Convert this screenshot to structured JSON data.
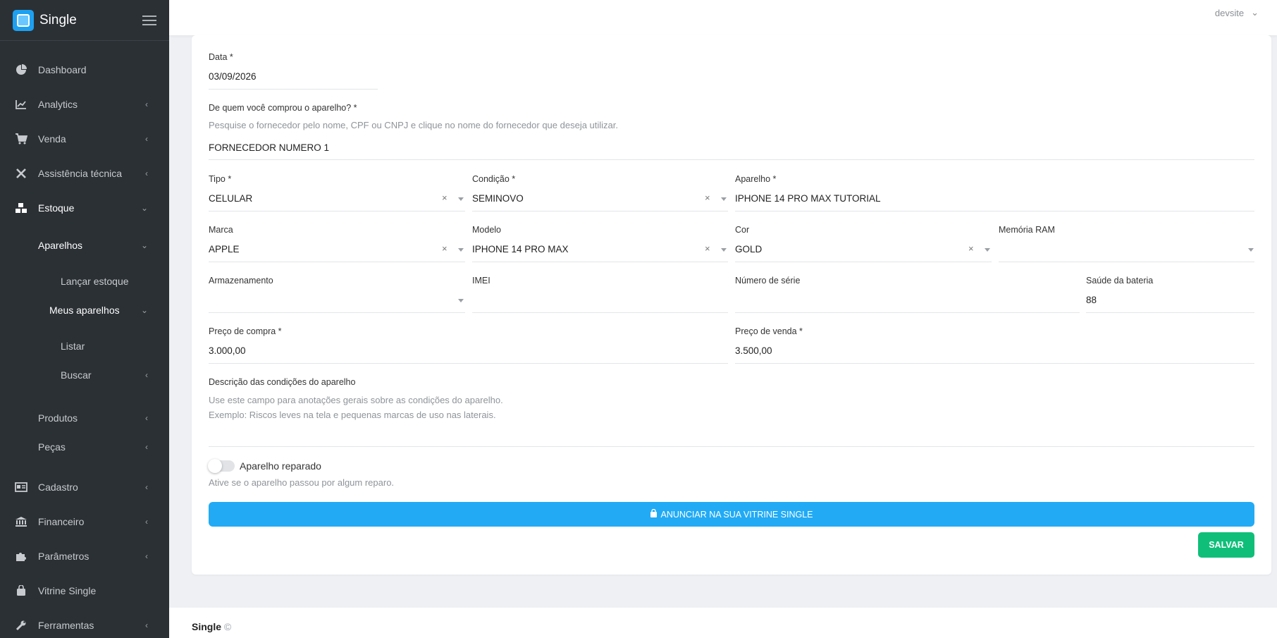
{
  "app": {
    "brand": "Single",
    "user": "devsite"
  },
  "sidebar": {
    "items": [
      {
        "label": "Dashboard",
        "icon": "pie-chart-icon"
      },
      {
        "label": "Analytics",
        "icon": "line-chart-icon"
      },
      {
        "label": "Venda",
        "icon": "cart-icon"
      },
      {
        "label": "Assistência técnica",
        "icon": "tools-icon"
      },
      {
        "label": "Estoque",
        "icon": "cubes-icon"
      },
      {
        "label": "Aparelhos"
      },
      {
        "label": "Lançar estoque"
      },
      {
        "label": "Meus aparelhos"
      },
      {
        "label": "Listar"
      },
      {
        "label": "Buscar"
      },
      {
        "label": "Produtos"
      },
      {
        "label": "Peças"
      },
      {
        "label": "Cadastro",
        "icon": "id-card-icon"
      },
      {
        "label": "Financeiro",
        "icon": "bank-icon"
      },
      {
        "label": "Parâmetros",
        "icon": "puzzle-icon"
      },
      {
        "label": "Vitrine Single",
        "icon": "bag-icon"
      },
      {
        "label": "Ferramentas",
        "icon": "wrench-icon"
      }
    ]
  },
  "form": {
    "data": {
      "label": "Data *",
      "value": "03/09/2026"
    },
    "fornecedor": {
      "label": "De quem você comprou o aparelho? *",
      "hint": "Pesquise o fornecedor pelo nome, CPF ou CNPJ e clique no nome do fornecedor que deseja utilizar.",
      "value": "FORNECEDOR NUMERO 1"
    },
    "tipo": {
      "label": "Tipo *",
      "value": "CELULAR"
    },
    "condicao": {
      "label": "Condição *",
      "value": "SEMINOVO"
    },
    "aparelho": {
      "label": "Aparelho *",
      "value": "IPHONE 14 PRO MAX TUTORIAL"
    },
    "marca": {
      "label": "Marca",
      "value": "APPLE"
    },
    "modelo": {
      "label": "Modelo",
      "value": "IPHONE 14 PRO MAX"
    },
    "cor": {
      "label": "Cor",
      "value": "GOLD"
    },
    "memoria": {
      "label": "Memória RAM",
      "value": ""
    },
    "armazenamento": {
      "label": "Armazenamento",
      "value": ""
    },
    "imei": {
      "label": "IMEI",
      "value": ""
    },
    "serie": {
      "label": "Número de série",
      "value": ""
    },
    "bateria": {
      "label": "Saúde da bateria",
      "value": "88"
    },
    "preco_compra": {
      "label": "Preço de compra *",
      "value": "3.000,00"
    },
    "preco_venda": {
      "label": "Preço de venda *",
      "value": "3.500,00"
    },
    "descricao": {
      "label": "Descrição das condições do aparelho",
      "hint1": "Use este campo para anotações gerais sobre as condições do aparelho.",
      "hint2": "Exemplo: Riscos leves na tela e pequenas marcas de uso nas laterais."
    },
    "reparado": {
      "label": "Aparelho reparado",
      "hint": "Ative se o aparelho passou por algum reparo.",
      "checked": false
    },
    "vitrine_button": "ANUNCIAR NA SUA VITRINE SINGLE",
    "save_button": "SALVAR",
    "clear_symbol": "×"
  },
  "footer": {
    "brand": "Single",
    "copyright": "©"
  },
  "colors": {
    "sidebar": "#2b3035",
    "primary": "#22aaf5",
    "success": "#0fbf79"
  }
}
